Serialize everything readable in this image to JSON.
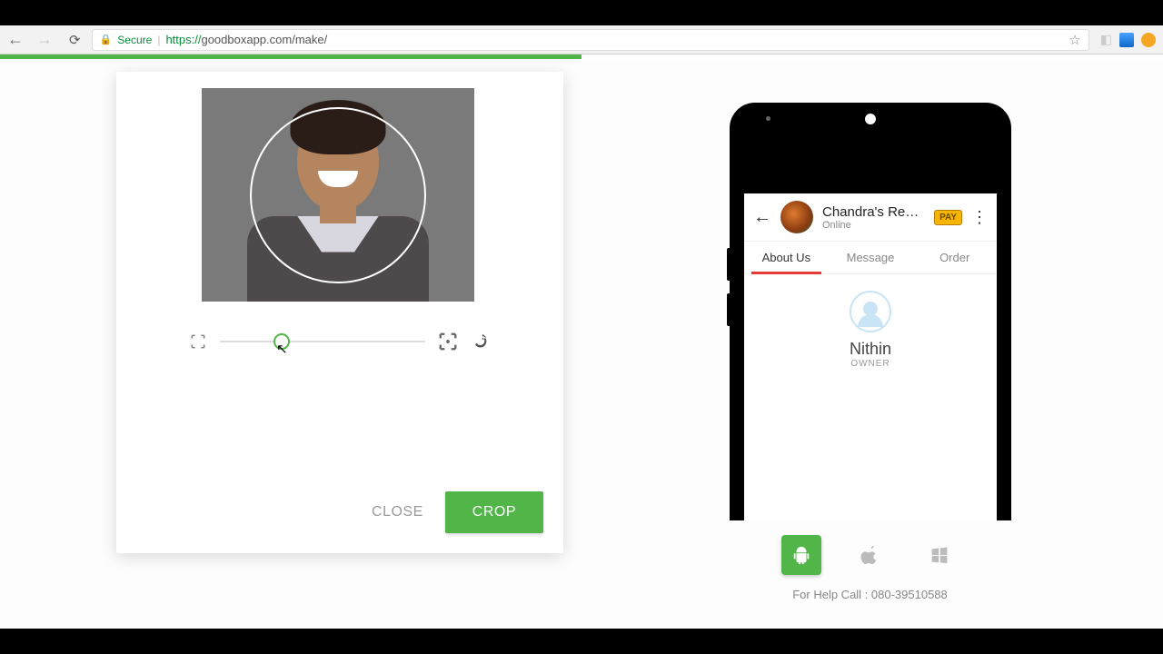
{
  "browser": {
    "secure_label": "Secure",
    "url_scheme": "https://",
    "url_rest": "goodboxapp.com/make/"
  },
  "crop_modal": {
    "close_label": "CLOSE",
    "crop_label": "CROP"
  },
  "phone_preview": {
    "shop_name": "Chandra's Restau...",
    "shop_status": "Online",
    "pay_label": "PAY",
    "tabs": {
      "about": "About Us",
      "message": "Message",
      "order": "Order"
    },
    "owner_name": "Nithin",
    "owner_role": "OWNER"
  },
  "footer": {
    "help_text": "For Help Call : 080-39510588"
  }
}
